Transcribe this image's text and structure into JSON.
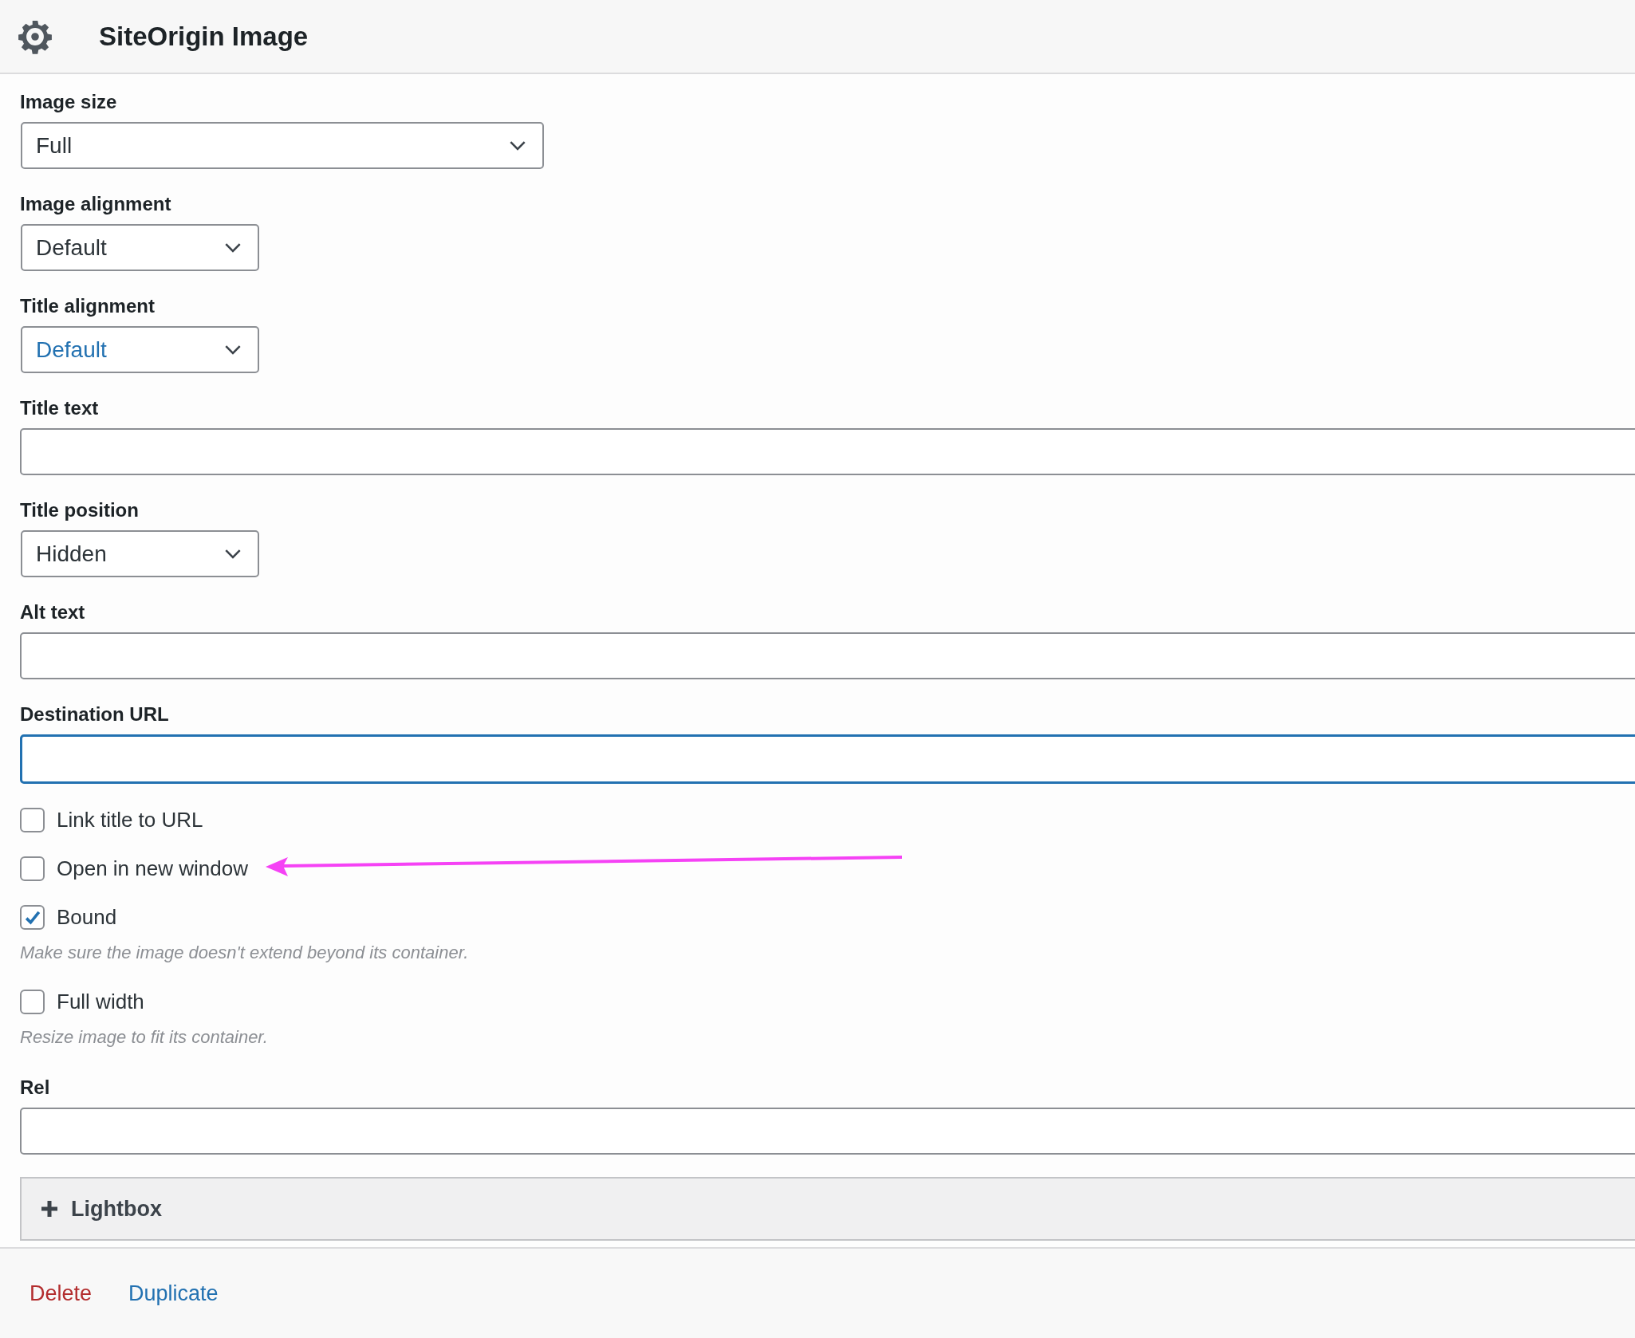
{
  "header": {
    "title": "SiteOrigin Image"
  },
  "fields": [
    {
      "kind": "select",
      "label": "Image size",
      "value": "Full",
      "wide": true,
      "highlighted": false
    },
    {
      "kind": "select",
      "label": "Image alignment",
      "value": "Default",
      "wide": false,
      "highlighted": false
    },
    {
      "kind": "select",
      "label": "Title alignment",
      "value": "Default",
      "wide": false,
      "highlighted": true
    },
    {
      "kind": "text",
      "label": "Title text",
      "focused": false
    },
    {
      "kind": "select",
      "label": "Title position",
      "value": "Hidden",
      "wide": false,
      "highlighted": false
    },
    {
      "kind": "text",
      "label": "Alt text",
      "focused": false
    },
    {
      "kind": "text",
      "label": "Destination URL",
      "focused": true
    },
    {
      "kind": "checkbox",
      "label": "Link title to URL",
      "checked": false
    },
    {
      "kind": "checkbox",
      "label": "Open in new window",
      "checked": false
    },
    {
      "kind": "checkbox",
      "label": "Bound",
      "checked": true,
      "description": "Make sure the image doesn't extend beyond its container."
    },
    {
      "kind": "checkbox",
      "label": "Full width",
      "checked": false,
      "description": "Resize image to fit its container."
    },
    {
      "kind": "text",
      "label": "Rel",
      "focused": false
    }
  ],
  "section": {
    "label": "Lightbox",
    "expanded": false
  },
  "actions": [
    {
      "kind": "danger",
      "label": "Delete"
    },
    {
      "kind": "link",
      "label": "Duplicate"
    }
  ]
}
